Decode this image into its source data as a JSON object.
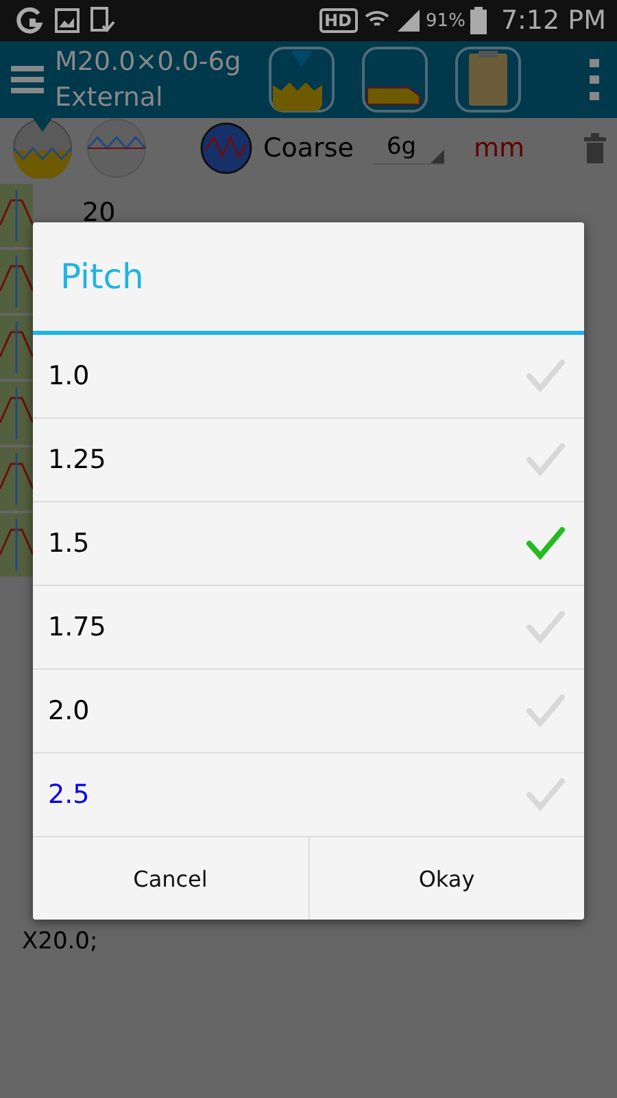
{
  "status_bar": {
    "hd": "HD",
    "battery": "91%",
    "time": "7:12 PM"
  },
  "app_bar": {
    "title": "M20.0×0.0-6g",
    "subtitle": "External"
  },
  "toolbar": {
    "series": "Coarse",
    "tolerance": "6g",
    "unit": "mm"
  },
  "background": {
    "size_value": "20",
    "code_line": "X20.0;"
  },
  "dialog": {
    "title": "Pitch",
    "options": [
      {
        "label": "1.0",
        "selected": false,
        "current": false
      },
      {
        "label": "1.25",
        "selected": false,
        "current": false
      },
      {
        "label": "1.5",
        "selected": true,
        "current": false
      },
      {
        "label": "1.75",
        "selected": false,
        "current": false
      },
      {
        "label": "2.0",
        "selected": false,
        "current": false
      },
      {
        "label": "2.5",
        "selected": false,
        "current": true
      }
    ],
    "buttons": [
      "Cancel",
      "Okay"
    ]
  }
}
